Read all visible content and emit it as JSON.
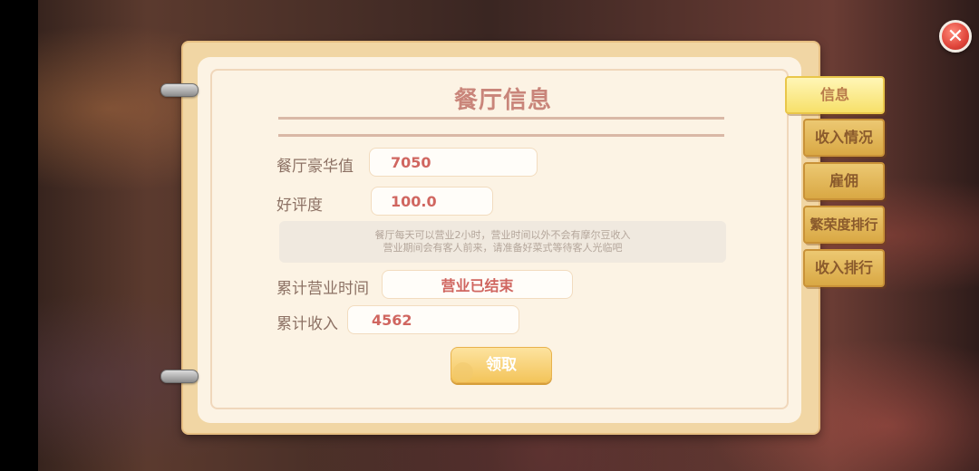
{
  "title": "餐厅信息",
  "close_icon": "close-icon",
  "fields": {
    "luxury_label": "餐厅豪华值",
    "luxury_value": "7050",
    "rating_label": "好评度",
    "rating_value": "100.0",
    "business_time_label": "累计营业时间",
    "business_time_value": "营业已结束",
    "income_label": "累计收入",
    "income_value": "4562"
  },
  "note": {
    "line1": "餐厅每天可以营业2小时，营业时间以外不会有摩尔豆收入",
    "line2": "营业期间会有客人前来，请准备好菜式等待客人光临吧"
  },
  "claim_button": "领取",
  "tabs": [
    {
      "label": "信息",
      "active": true
    },
    {
      "label": "收入情况",
      "active": false
    },
    {
      "label": "雇佣",
      "active": false
    },
    {
      "label": "繁荣度排行",
      "active": false
    },
    {
      "label": "收入排行",
      "active": false
    }
  ],
  "colors": {
    "title": "#c9857a",
    "value_text": "#d06660",
    "tab_active": "#f7e06a",
    "tab": "#d9a844"
  }
}
